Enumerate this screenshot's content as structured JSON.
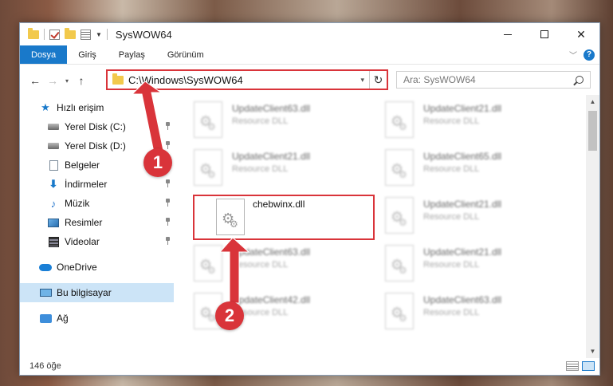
{
  "window": {
    "title": "SysWOW64",
    "controls": {
      "minimize": "—",
      "maximize": "☐",
      "close": "✕"
    }
  },
  "ribbon": {
    "tabs": [
      {
        "label": "Dosya",
        "active": true
      },
      {
        "label": "Giriş",
        "active": false
      },
      {
        "label": "Paylaş",
        "active": false
      },
      {
        "label": "Görünüm",
        "active": false
      }
    ],
    "help_label": "?"
  },
  "navigation": {
    "back": "←",
    "forward": "→",
    "recent": "▾",
    "up": "↑",
    "address": "C:\\Windows\\SysWOW64",
    "refresh": "↻",
    "dropdown": "▾",
    "search_placeholder": "Ara: SysWOW64"
  },
  "sidebar": {
    "quick_access": "Hızlı erişim",
    "items": [
      {
        "label": "Yerel Disk (C:)",
        "icon": "disk-icon",
        "pinned": true
      },
      {
        "label": "Yerel Disk (D:)",
        "icon": "disk-icon",
        "pinned": true
      },
      {
        "label": "Belgeler",
        "icon": "documents-icon",
        "pinned": true
      },
      {
        "label": "İndirmeler",
        "icon": "download-icon",
        "pinned": true
      },
      {
        "label": "Müzik",
        "icon": "music-icon",
        "pinned": true
      },
      {
        "label": "Resimler",
        "icon": "pictures-icon",
        "pinned": true
      },
      {
        "label": "Videolar",
        "icon": "videos-icon",
        "pinned": true
      }
    ],
    "onedrive": "OneDrive",
    "this_pc": "Bu bilgisayar",
    "network": "Ağ"
  },
  "files": [
    {
      "name": "UpdateClient63.dll",
      "type": "Resource DLL",
      "blurred": true
    },
    {
      "name": "UpdateClient21.dll",
      "type": "Resource DLL",
      "blurred": true
    },
    {
      "name": "UpdateClient21.dll",
      "type": "Resource DLL",
      "blurred": true
    },
    {
      "name": "UpdateClient65.dll",
      "type": "Resource DLL",
      "blurred": true
    },
    {
      "name": "chebwinx.dll",
      "type": "",
      "blurred": false
    },
    {
      "name": "UpdateClient21.dll",
      "type": "Resource DLL",
      "blurred": true
    },
    {
      "name": "UpdateClient63.dll",
      "type": "Resource DLL",
      "blurred": true
    },
    {
      "name": "UpdateClient21.dll",
      "type": "Resource DLL",
      "blurred": true
    },
    {
      "name": "UpdateClient42.dll",
      "type": "Resource DLL",
      "blurred": true
    },
    {
      "name": "UpdateClient63.dll",
      "type": "Resource DLL",
      "blurred": true
    }
  ],
  "status": {
    "item_count": "146 öğe"
  },
  "annotations": [
    {
      "label": "1",
      "color": "#d9343a"
    },
    {
      "label": "2",
      "color": "#d9343a"
    }
  ]
}
